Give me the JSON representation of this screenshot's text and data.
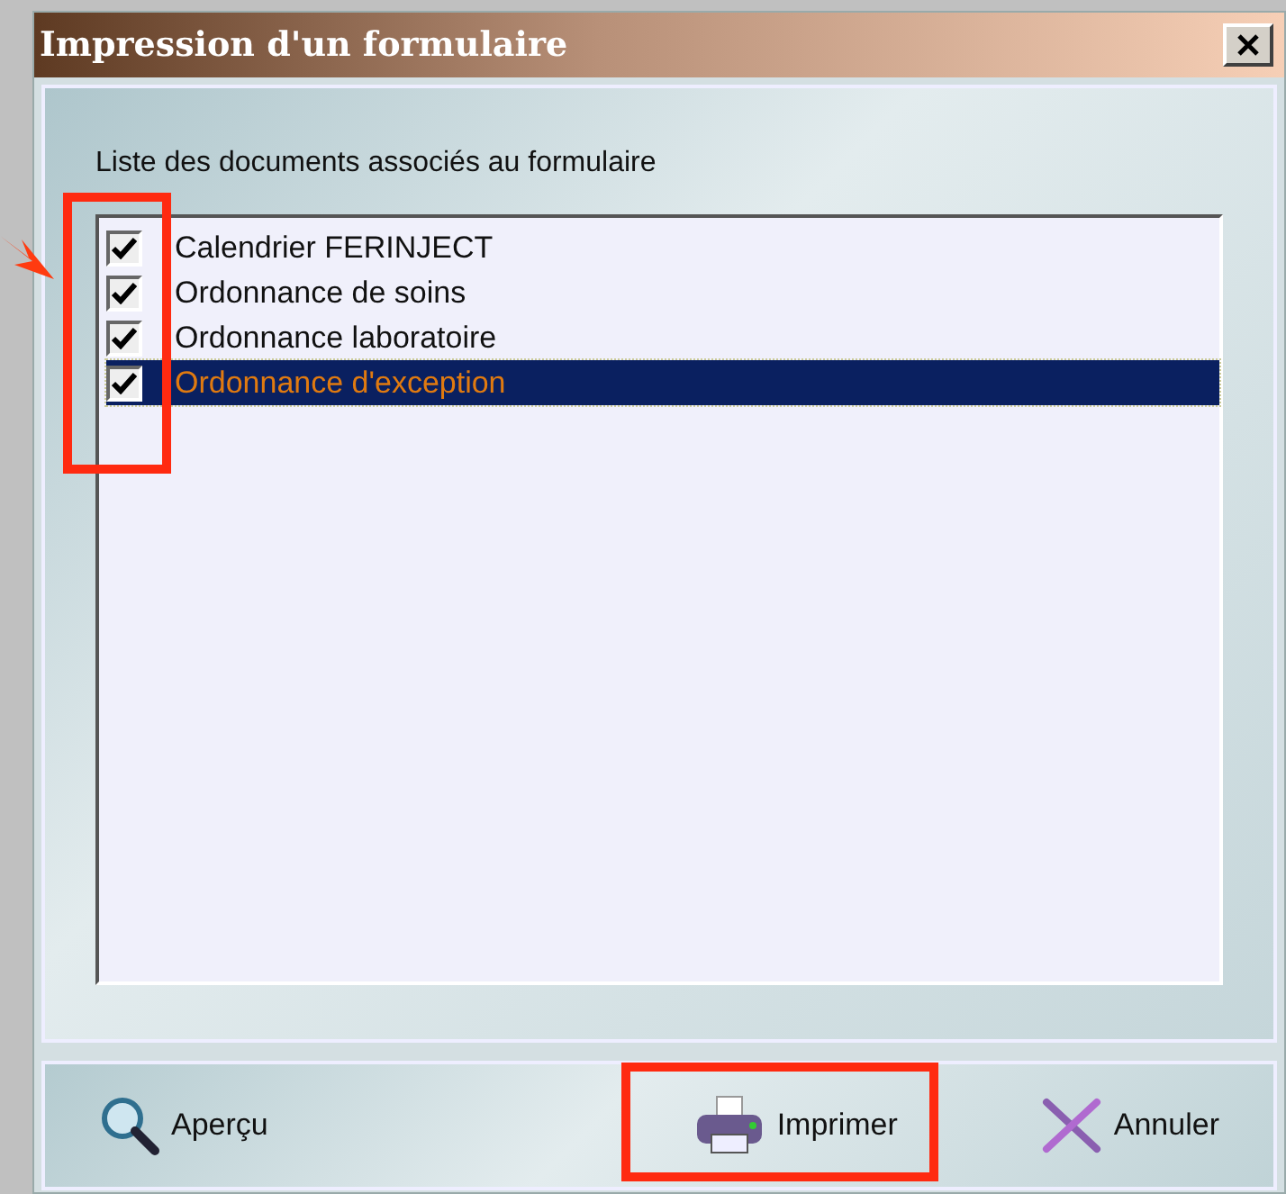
{
  "window": {
    "title": "Impression d'un formulaire"
  },
  "list_label": "Liste des documents associés au formulaire",
  "documents": [
    {
      "label": "Calendrier FERINJECT",
      "checked": true,
      "selected": false
    },
    {
      "label": "Ordonnance de soins",
      "checked": true,
      "selected": false
    },
    {
      "label": "Ordonnance laboratoire",
      "checked": true,
      "selected": false
    },
    {
      "label": "Ordonnance d'exception",
      "checked": true,
      "selected": true
    }
  ],
  "buttons": [
    {
      "kind": "preview",
      "label": "Aperçu"
    },
    {
      "kind": "print",
      "label": "Imprimer"
    },
    {
      "kind": "cancel",
      "label": "Annuler"
    }
  ]
}
